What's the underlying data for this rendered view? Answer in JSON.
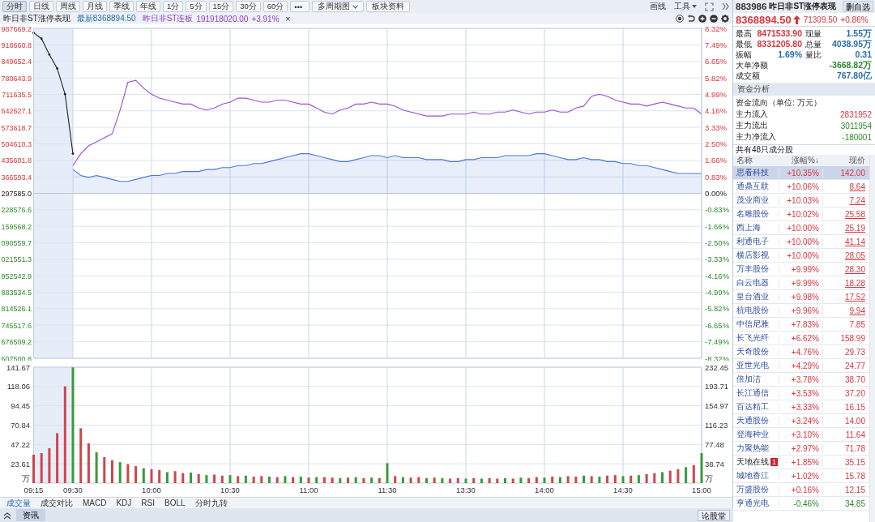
{
  "toolbar": {
    "periods": [
      {
        "label": "分时",
        "selected": true
      },
      {
        "label": "日线",
        "selected": false
      },
      {
        "label": "周线",
        "selected": false
      },
      {
        "label": "月线",
        "selected": false
      },
      {
        "label": "季线",
        "selected": false
      },
      {
        "label": "年线",
        "selected": false
      },
      {
        "label": "1分",
        "selected": false
      },
      {
        "label": "5分",
        "selected": false
      },
      {
        "label": "15分",
        "selected": false
      },
      {
        "label": "30分",
        "selected": false
      },
      {
        "label": "60分",
        "selected": false
      },
      {
        "label": "•••",
        "selected": false
      }
    ],
    "multi_period": "多周期图",
    "sector_info": "板块资料",
    "draw": "画线",
    "tools": "工具"
  },
  "chart_header": {
    "title": "昨日非ST涨停表现",
    "latest": "最新8368894.50",
    "compare_name": "昨日非ST连板",
    "compare_value": "191918020.00",
    "compare_change": "+3.91%",
    "close": "×"
  },
  "price_chart": {
    "price_axis_labels": [
      "987669.2",
      "918660.8",
      "849652.4",
      "780643.9",
      "711635.5",
      "642627.1",
      "573618.7",
      "504610.3",
      "435601.8",
      "366593.4",
      "297585.0",
      "228576.6",
      "159568.2",
      "090559.7",
      "021551.3",
      "952542.9",
      "883534.5",
      "814526.1",
      "745517.6",
      "676509.2",
      "607500.8"
    ],
    "chart_data": {
      "type": "line",
      "grid": true,
      "series": [
        {
          "color": "#222222",
          "values": [
            8.1,
            7.8,
            7.0,
            6.3,
            5.0,
            2.0,
            null,
            null,
            null,
            null,
            null,
            null,
            null,
            null,
            null,
            null,
            null,
            null,
            null,
            null,
            null,
            null,
            null,
            null,
            null,
            null,
            null,
            null,
            null,
            null,
            null,
            null,
            null,
            null,
            null,
            null,
            null,
            null,
            null,
            null,
            null,
            null,
            null,
            null,
            null,
            null,
            null,
            null,
            null,
            null,
            null,
            null,
            null,
            null,
            null,
            null,
            null,
            null,
            null,
            null,
            null,
            null,
            null,
            null,
            null,
            null,
            null,
            null,
            null,
            null,
            null,
            null,
            null,
            null,
            null,
            null,
            null,
            null,
            null,
            null,
            null,
            null,
            null,
            null,
            null,
            null
          ]
        },
        {
          "color": "#9b4fd0",
          "values": [
            null,
            null,
            null,
            null,
            null,
            1.4,
            2.0,
            2.4,
            2.6,
            2.8,
            3.0,
            4.2,
            5.6,
            5.7,
            5.3,
            5.0,
            4.8,
            4.7,
            4.6,
            4.5,
            4.5,
            4.3,
            4.2,
            4.3,
            4.5,
            4.6,
            4.8,
            4.8,
            4.7,
            4.6,
            4.6,
            4.7,
            4.7,
            4.6,
            4.5,
            4.5,
            4.3,
            4.1,
            4.0,
            4.2,
            4.3,
            4.5,
            4.5,
            4.6,
            4.5,
            4.5,
            4.4,
            4.2,
            4.1,
            4.0,
            3.9,
            3.9,
            3.9,
            4.0,
            4.0,
            4.0,
            4.1,
            4.0,
            4.0,
            4.1,
            4.1,
            4.2,
            4.1,
            4.0,
            4.1,
            4.1,
            4.2,
            4.1,
            4.1,
            4.3,
            4.4,
            4.9,
            5.0,
            4.9,
            4.7,
            4.6,
            4.5,
            4.5,
            4.4,
            4.5,
            4.6,
            4.5,
            4.4,
            4.3,
            4.3,
            4.0
          ]
        },
        {
          "color": "#4a78d8",
          "values": [
            null,
            null,
            null,
            null,
            null,
            1.2,
            0.9,
            0.8,
            0.9,
            0.8,
            0.7,
            0.6,
            0.6,
            0.7,
            0.8,
            0.9,
            0.9,
            1.0,
            1.0,
            1.1,
            1.1,
            1.1,
            1.2,
            1.2,
            1.3,
            1.3,
            1.4,
            1.4,
            1.5,
            1.5,
            1.6,
            1.7,
            1.8,
            1.9,
            2.0,
            2.0,
            1.9,
            1.8,
            1.7,
            1.6,
            1.6,
            1.7,
            1.8,
            1.9,
            1.9,
            1.8,
            1.9,
            1.8,
            1.8,
            1.8,
            1.7,
            1.7,
            1.7,
            1.6,
            1.6,
            1.7,
            1.7,
            1.8,
            1.8,
            1.8,
            1.9,
            1.9,
            1.9,
            1.9,
            2.0,
            2.0,
            1.9,
            1.8,
            1.7,
            1.7,
            1.8,
            1.7,
            1.7,
            1.6,
            1.6,
            1.5,
            1.5,
            1.4,
            1.4,
            1.3,
            1.2,
            1.1,
            1.0,
            1.0,
            1.0,
            1.0
          ]
        }
      ],
      "ylim": [
        -8.32,
        8.32
      ],
      "yticks": [
        {
          "value": 8.32,
          "label": "8.32%"
        },
        {
          "value": 7.49,
          "label": "7.49%"
        },
        {
          "value": 6.65,
          "label": "6.65%"
        },
        {
          "value": 5.82,
          "label": "5.82%"
        },
        {
          "value": 4.99,
          "label": "4.99%"
        },
        {
          "value": 4.16,
          "label": "4.16%"
        },
        {
          "value": 3.33,
          "label": "3.33%"
        },
        {
          "value": 2.5,
          "label": "2.50%"
        },
        {
          "value": 1.66,
          "label": "1.66%"
        },
        {
          "value": 0.83,
          "label": "0.83%"
        },
        {
          "value": 0,
          "label": "0.00%"
        },
        {
          "value": -0.83,
          "label": "-0.83%"
        },
        {
          "value": -1.66,
          "label": "-1.66%"
        },
        {
          "value": -2.5,
          "label": "-2.50%"
        },
        {
          "value": -3.33,
          "label": "-3.33%"
        },
        {
          "value": -4.16,
          "label": "-4.16%"
        },
        {
          "value": -4.99,
          "label": "-4.99%"
        },
        {
          "value": -5.82,
          "label": "-5.82%"
        },
        {
          "value": -6.65,
          "label": "-6.65%"
        },
        {
          "value": -7.49,
          "label": "-7.49%"
        },
        {
          "value": -8.32,
          "label": "-8.32%"
        }
      ]
    }
  },
  "volume_chart": {
    "left_axis_labels": [
      "141.67",
      "118.06",
      "94.45",
      "70.84",
      "47.22",
      "23.61"
    ],
    "left_unit": "万",
    "right_unit": "万",
    "chart_data": {
      "type": "bar",
      "grid": true,
      "categories": [
        "09:15",
        null,
        null,
        null,
        null,
        "09:30",
        null,
        null,
        null,
        null,
        null,
        null,
        null,
        null,
        null,
        "10:00",
        null,
        null,
        null,
        null,
        null,
        null,
        null,
        null,
        null,
        "10:30",
        null,
        null,
        null,
        null,
        null,
        null,
        null,
        null,
        null,
        "11:00",
        null,
        null,
        null,
        null,
        null,
        null,
        null,
        null,
        null,
        "11:30",
        null,
        null,
        null,
        null,
        null,
        null,
        null,
        null,
        null,
        "13:30",
        null,
        null,
        null,
        null,
        null,
        null,
        null,
        null,
        null,
        "14:00",
        null,
        null,
        null,
        null,
        null,
        null,
        null,
        null,
        null,
        "14:30",
        null,
        null,
        null,
        null,
        null,
        null,
        null,
        null,
        null,
        "15:00"
      ],
      "series": [
        {
          "color": "#d0454d",
          "values": [
            57,
            60,
            70,
            100,
            194,
            null,
            110,
            80,
            null,
            52,
            46,
            null,
            38,
            34,
            null,
            28,
            26,
            null,
            24,
            20,
            null,
            18,
            null,
            17,
            15,
            null,
            14,
            null,
            13,
            14,
            null,
            12,
            null,
            12,
            null,
            11,
            null,
            12,
            11,
            null,
            11,
            null,
            10,
            null,
            10,
            null,
            14,
            null,
            11,
            12,
            null,
            11,
            null,
            9,
            10,
            null,
            10,
            null,
            10,
            9,
            null,
            9,
            null,
            10,
            12,
            null,
            13,
            null,
            14,
            13,
            null,
            14,
            null,
            15,
            16,
            null,
            15,
            null,
            18,
            20,
            null,
            25,
            28,
            null,
            36,
            null
          ]
        },
        {
          "color": "#3a9a3a",
          "values": [
            null,
            null,
            null,
            null,
            null,
            232,
            null,
            null,
            62,
            null,
            null,
            42,
            null,
            null,
            30,
            null,
            null,
            22,
            null,
            null,
            21,
            null,
            16,
            null,
            null,
            16,
            null,
            15,
            null,
            null,
            13,
            null,
            14,
            null,
            13,
            null,
            12,
            null,
            null,
            10,
            null,
            12,
            null,
            11,
            null,
            40,
            null,
            12,
            null,
            null,
            10,
            null,
            10,
            null,
            null,
            9,
            null,
            9,
            null,
            null,
            10,
            null,
            11,
            null,
            null,
            11,
            null,
            12,
            null,
            null,
            15,
            null,
            13,
            null,
            null,
            14,
            null,
            16,
            null,
            null,
            22,
            null,
            null,
            32,
            null,
            60
          ]
        }
      ],
      "ylim": [
        0,
        232.45
      ],
      "yticks": [
        {
          "value": 232.45,
          "label": "232.45"
        },
        {
          "value": 193.71,
          "label": "193.71"
        },
        {
          "value": 154.97,
          "label": "154.97"
        },
        {
          "value": 116.23,
          "label": "116.23"
        },
        {
          "value": 77.48,
          "label": "77.48"
        },
        {
          "value": 38.74,
          "label": "38.74"
        }
      ]
    }
  },
  "indicator_tabs": [
    {
      "label": "成交量",
      "selected": true
    },
    {
      "label": "成交对比",
      "selected": false
    },
    {
      "label": "MACD",
      "selected": false
    },
    {
      "label": "KDJ",
      "selected": false
    },
    {
      "label": "RSI",
      "selected": false
    },
    {
      "label": "BOLL",
      "selected": false
    },
    {
      "label": "分时九转",
      "selected": false
    }
  ],
  "footer": {
    "tab": "资讯",
    "button": "论股堂"
  },
  "quote": {
    "code": "883986",
    "name": "昨日非ST涨停表现",
    "remove_button": "删自选",
    "price": "8368894.50",
    "rising": true,
    "color": "#d9363e",
    "change": "71309.50",
    "change_pct": "+0.86%",
    "stats": [
      [
        {
          "label": "最高",
          "value": "8471533.90",
          "color": "#d9363e"
        },
        {
          "label": "现量",
          "value": "1.55万",
          "color": "#2a6db0"
        }
      ],
      [
        {
          "label": "最低",
          "value": "8331205.80",
          "color": "#d9363e"
        },
        {
          "label": "总量",
          "value": "4038.95万",
          "color": "#2a6db0"
        }
      ],
      [
        {
          "label": "振幅",
          "value": "1.69%",
          "color": "#2a6db0"
        },
        {
          "label": "量比",
          "value": "0.31",
          "color": "#2a6db0"
        }
      ],
      [
        {
          "label": "大单净额",
          "value": "-3668.82万",
          "color": "#2f8a2f"
        }
      ],
      [
        {
          "label": "成交额",
          "value": "767.80亿",
          "color": "#2a6db0"
        }
      ]
    ]
  },
  "fund_flow": {
    "title": "资金分析",
    "caption": "资金流向（单位: 万元）",
    "rows": [
      {
        "label": "主力流入",
        "value": "2831952",
        "color": "#d9363e"
      },
      {
        "label": "主力流出",
        "value": "3011954",
        "color": "#2f8a2f"
      },
      {
        "label": "主力净流入",
        "value": "-180001",
        "color": "#2f8a2f"
      }
    ]
  },
  "constituents": {
    "count_text": "共有48只成分股",
    "columns": [
      "名称",
      "涨幅%↓",
      "现价"
    ],
    "rows": [
      {
        "name": "思看科技",
        "change": "+10.35%",
        "price": "142.00",
        "color": "#d9363e",
        "limit_up": false,
        "selected": true
      },
      {
        "name": "通鼎互联",
        "change": "+10.06%",
        "price": "8.64",
        "color": "#d9363e",
        "limit_up": true,
        "selected": false
      },
      {
        "name": "茂业商业",
        "change": "+10.03%",
        "price": "7.24",
        "color": "#d9363e",
        "limit_up": true,
        "selected": false
      },
      {
        "name": "名雕股份",
        "change": "+10.02%",
        "price": "25.58",
        "color": "#d9363e",
        "limit_up": true,
        "selected": false
      },
      {
        "name": "西上海",
        "change": "+10.00%",
        "price": "25.19",
        "color": "#d9363e",
        "limit_up": true,
        "selected": false
      },
      {
        "name": "利通电子",
        "change": "+10.00%",
        "price": "41.14",
        "color": "#d9363e",
        "limit_up": true,
        "selected": false
      },
      {
        "name": "横店影视",
        "change": "+10.00%",
        "price": "28.05",
        "color": "#d9363e",
        "limit_up": true,
        "selected": false
      },
      {
        "name": "万丰股份",
        "change": "+9.99%",
        "price": "28.30",
        "color": "#d9363e",
        "limit_up": true,
        "selected": false
      },
      {
        "name": "白云电器",
        "change": "+9.99%",
        "price": "18.28",
        "color": "#d9363e",
        "limit_up": true,
        "selected": false
      },
      {
        "name": "皇台酒业",
        "change": "+9.98%",
        "price": "17.52",
        "color": "#d9363e",
        "limit_up": true,
        "selected": false
      },
      {
        "name": "杭电股份",
        "change": "+9.96%",
        "price": "9.94",
        "color": "#d9363e",
        "limit_up": true,
        "selected": false
      },
      {
        "name": "中信尼雅",
        "change": "+7.83%",
        "price": "7.85",
        "color": "#d9363e",
        "limit_up": false,
        "selected": false
      },
      {
        "name": "长飞光纤",
        "change": "+6.62%",
        "price": "158.99",
        "color": "#d9363e",
        "limit_up": false,
        "selected": false
      },
      {
        "name": "天奇股份",
        "change": "+4.76%",
        "price": "29.73",
        "color": "#d9363e",
        "limit_up": false,
        "selected": false
      },
      {
        "name": "亚世光电",
        "change": "+4.29%",
        "price": "24.77",
        "color": "#d9363e",
        "limit_up": false,
        "selected": false
      },
      {
        "name": "倍加洁",
        "change": "+3.78%",
        "price": "38.70",
        "color": "#d9363e",
        "limit_up": false,
        "selected": false
      },
      {
        "name": "长江通信",
        "change": "+3.53%",
        "price": "37.20",
        "color": "#d9363e",
        "limit_up": false,
        "selected": false
      },
      {
        "name": "百达精工",
        "change": "+3.33%",
        "price": "16.15",
        "color": "#d9363e",
        "limit_up": false,
        "selected": false
      },
      {
        "name": "天通股份",
        "change": "+3.24%",
        "price": "14.00",
        "color": "#d9363e",
        "limit_up": false,
        "selected": false
      },
      {
        "name": "登海种业",
        "change": "+3.10%",
        "price": "11.64",
        "color": "#d9363e",
        "limit_up": false,
        "selected": false
      },
      {
        "name": "力聚热能",
        "change": "+2.97%",
        "price": "71.78",
        "color": "#d9363e",
        "limit_up": false,
        "selected": false
      },
      {
        "name": "天地在线",
        "change": "+1.85%",
        "price": "35.15",
        "color": "#d9363e",
        "limit_up": false,
        "selected": false,
        "badge": "1"
      },
      {
        "name": "城地香江",
        "change": "+1.02%",
        "price": "15.78",
        "color": "#d9363e",
        "limit_up": false,
        "selected": false
      },
      {
        "name": "万盛股份",
        "change": "+0.16%",
        "price": "12.15",
        "color": "#d9363e",
        "limit_up": false,
        "selected": false
      },
      {
        "name": "亨通光电",
        "change": "-0.46%",
        "price": "34.85",
        "color": "#2f8a2f",
        "limit_up": false,
        "selected": false
      }
    ]
  }
}
